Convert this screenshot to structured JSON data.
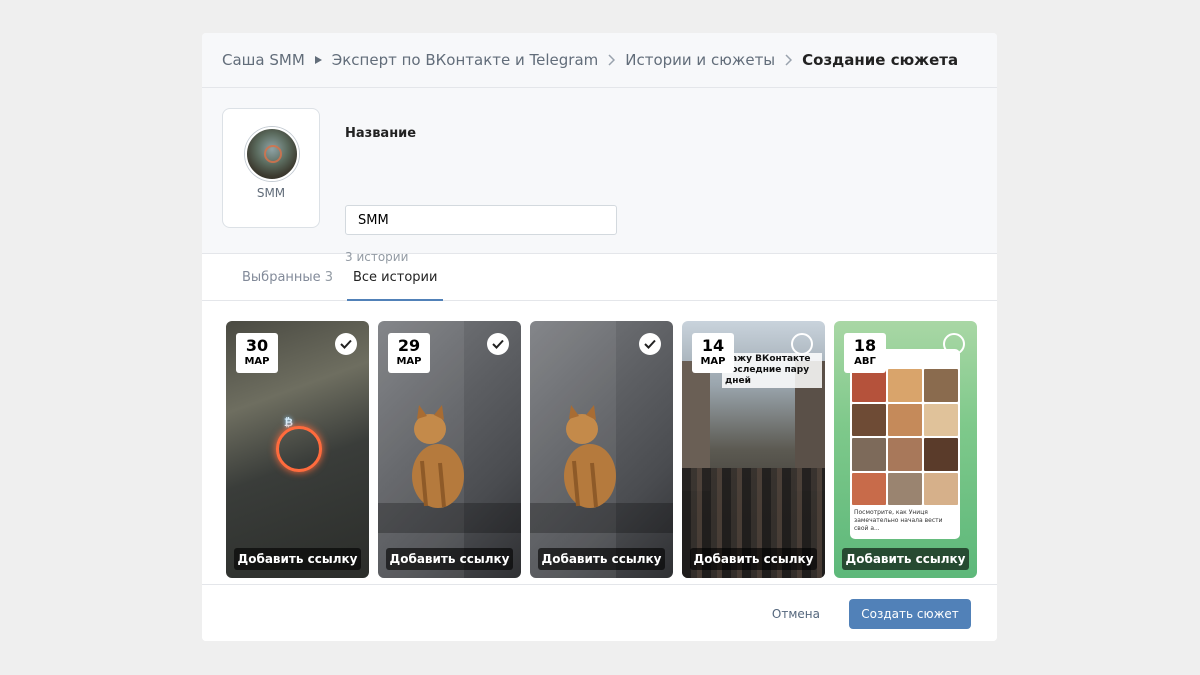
{
  "breadcrumbs": [
    {
      "label": "Саша SMM"
    },
    {
      "label": "Эксперт по ВКонтакте и Telegram"
    },
    {
      "label": "Истории и сюжеты"
    },
    {
      "label": "Создание сюжета"
    }
  ],
  "cover": {
    "label": "SMM"
  },
  "form": {
    "name_label": "Название",
    "name_value": "SMM",
    "stories_count": "3 истории"
  },
  "tabs": [
    {
      "label": "Выбранные",
      "count": "3",
      "active": false
    },
    {
      "label": "Все истории",
      "count": "",
      "active": true
    }
  ],
  "stories": [
    {
      "day": "30",
      "month": "МАР",
      "selected": true,
      "link_label": "Добавить ссылку"
    },
    {
      "day": "29",
      "month": "МАР",
      "selected": true,
      "link_label": "Добавить ссылку"
    },
    {
      "day": "",
      "month": "",
      "selected": true,
      "link_label": "Добавить ссылку"
    },
    {
      "day": "14",
      "month": "МАР",
      "selected": false,
      "link_label": "Добавить ссылку",
      "overlay": "кажу ВКонтакте последние пару дней"
    },
    {
      "day": "18",
      "month": "АВГ",
      "selected": false,
      "link_label": "Добавить ссылку",
      "caption": "Посмотрите, как Униця замечательно начала вести свой а..."
    }
  ],
  "footer": {
    "cancel_label": "Отмена",
    "create_label": "Создать сюжет"
  },
  "colors": {
    "accent": "#5181b8",
    "background": "#efefef",
    "panel": "#f7f8fa"
  }
}
